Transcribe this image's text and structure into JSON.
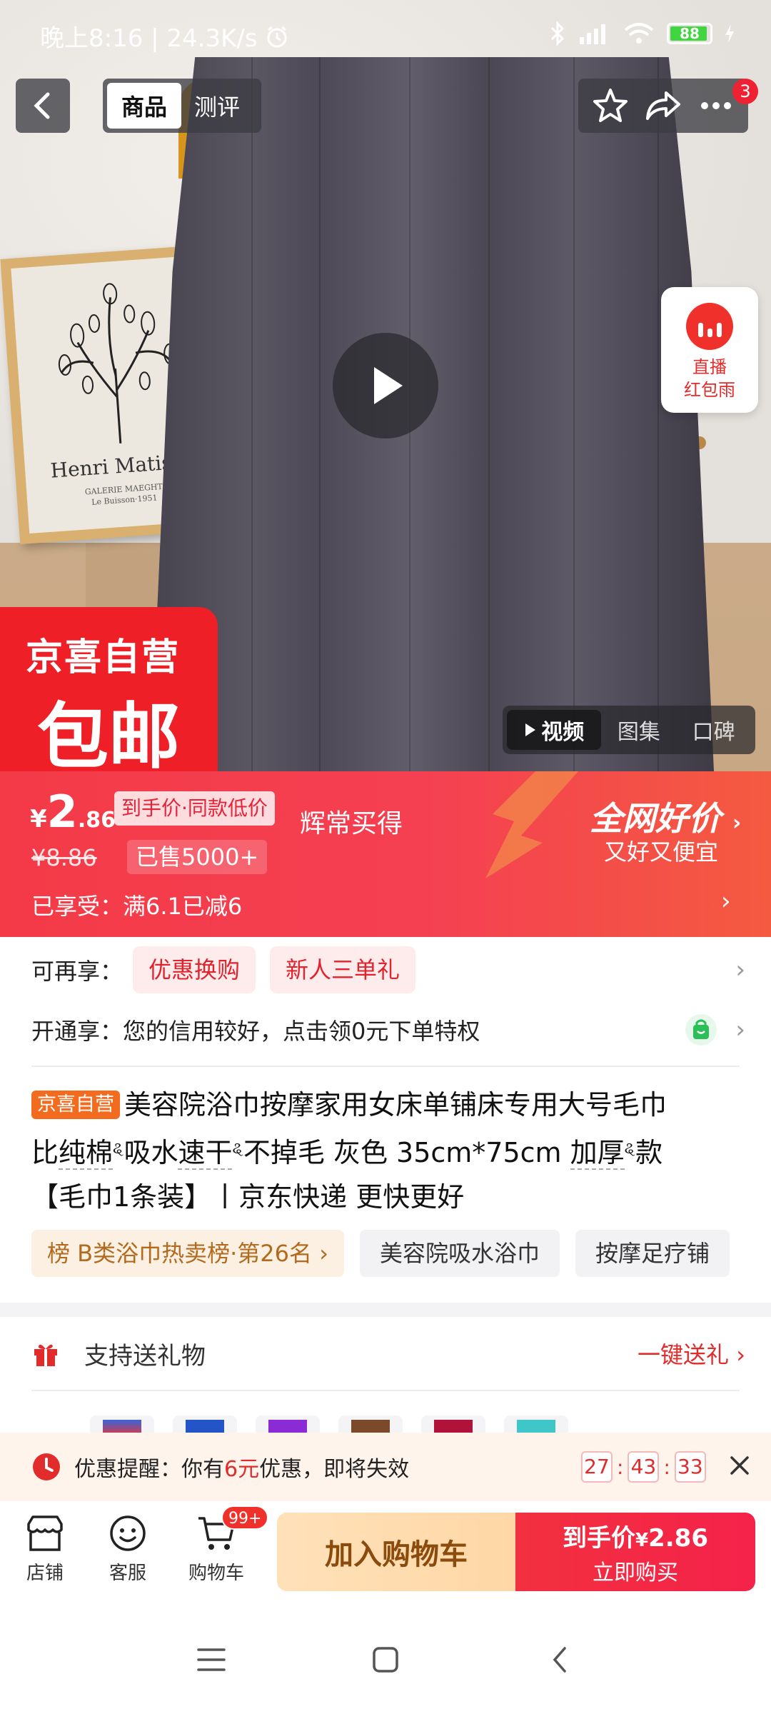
{
  "status_bar": {
    "time_speed": "晚上8:16 | 24.3K/s",
    "battery": "88"
  },
  "top_nav": {
    "tabs": [
      "商品",
      "测评"
    ],
    "notification_count": "3"
  },
  "hero": {
    "painting_title": "Henri Matisse",
    "painting_sub": "GALERIE MAEGHT\nLe Buisson·1951",
    "live_label": "直播\n红包雨",
    "badge_top": "京喜自营",
    "badge_main": "包邮",
    "media_tabs": [
      "视频",
      "图集",
      "口碑"
    ]
  },
  "price": {
    "yen": "¥",
    "int": "2",
    "dec": ".86",
    "tag": "到手价·同款低价",
    "slogan": "辉常买得",
    "original": "¥8.86",
    "sold": "已售5000+",
    "best_title": "全网好价",
    "best_sub": "又好又便宜",
    "enjoyed": "已享受：满6.1已减6"
  },
  "benefits": {
    "more_label": "可再享：",
    "chips": [
      "优惠换购",
      "新人三单礼"
    ],
    "open_label": "开通享：您的信用较好，点击领0元下单特权"
  },
  "product": {
    "jd_tag": "京喜自营",
    "title_1": "美容院浴巾按摩家用女床单铺床专用大号毛巾",
    "title_2a": "比",
    "title_2b": "纯棉",
    "title_2c": "吸水",
    "title_2d": "速干",
    "title_2e": "不掉毛 灰色 35cm*75cm ",
    "title_2f": "加厚",
    "title_2g": "款",
    "title_3": "【毛巾1条装】丨京东快递 更快更好",
    "rank": "榜 B类浴巾热卖榜·第26名",
    "tags": [
      "美容院吸水浴巾",
      "按摩足疗铺"
    ]
  },
  "gift": {
    "label": "支持送礼物",
    "action": "一键送礼"
  },
  "coupon": {
    "text_a": "优惠提醒：你有",
    "text_hi": "6元",
    "text_b": "优惠，即将失效",
    "h": "27",
    "m": "43",
    "s": "33"
  },
  "bottom_bar": {
    "store": "店铺",
    "service": "客服",
    "cart": "购物车",
    "cart_badge": "99+",
    "add_cart": "加入购物车",
    "buy_prefix": "到手价",
    "buy_yen": "¥",
    "buy_price": "2.86",
    "buy_now": "立即购买"
  },
  "colors": {
    "brand_red": "#f43a47",
    "accent_orange": "#f26b1e",
    "cart_btn": "#ffd7a6"
  }
}
